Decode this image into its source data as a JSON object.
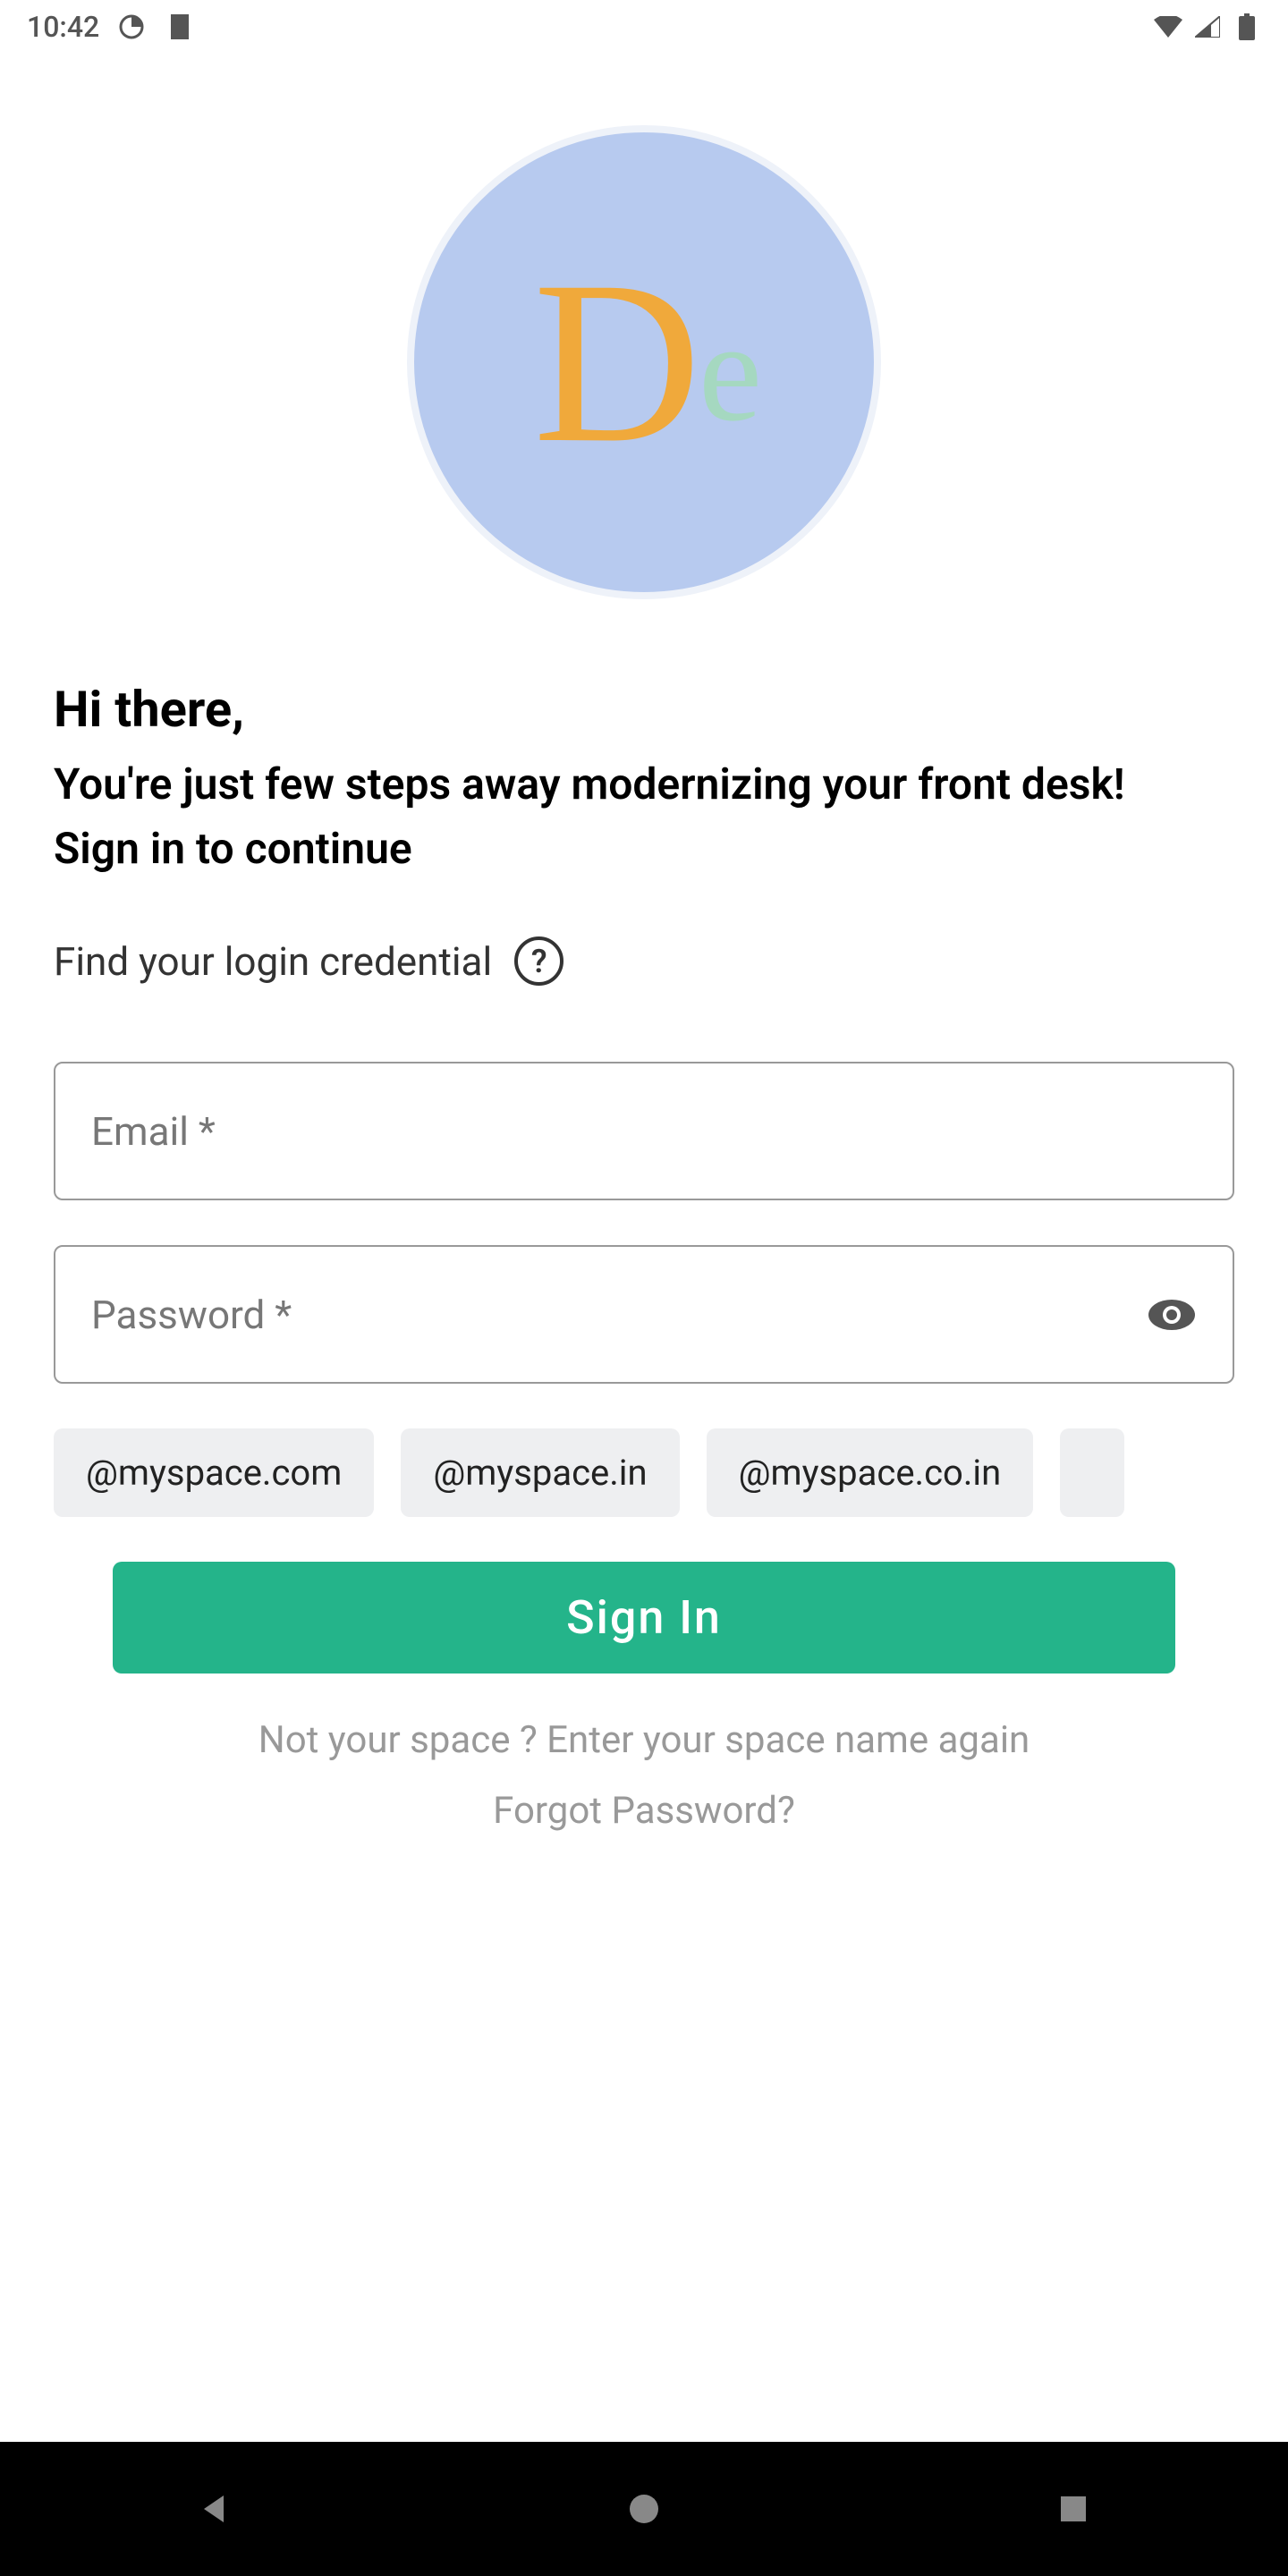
{
  "status_bar": {
    "time": "10:42"
  },
  "logo": {
    "letter_d": "D",
    "letter_e": "e"
  },
  "greeting": "Hi there,",
  "subtitle": "You're just few steps away modernizing your front desk!",
  "signin_prompt": "Sign in to continue",
  "find_credential": "Find your login credential",
  "inputs": {
    "email_placeholder": "Email *",
    "password_placeholder": "Password *"
  },
  "chips": [
    "@myspace.com",
    "@myspace.in",
    "@myspace.co.in"
  ],
  "signin_label": "Sign In",
  "not_space": "Not your space ? Enter your space name again",
  "forgot_password": "Forgot Password?"
}
